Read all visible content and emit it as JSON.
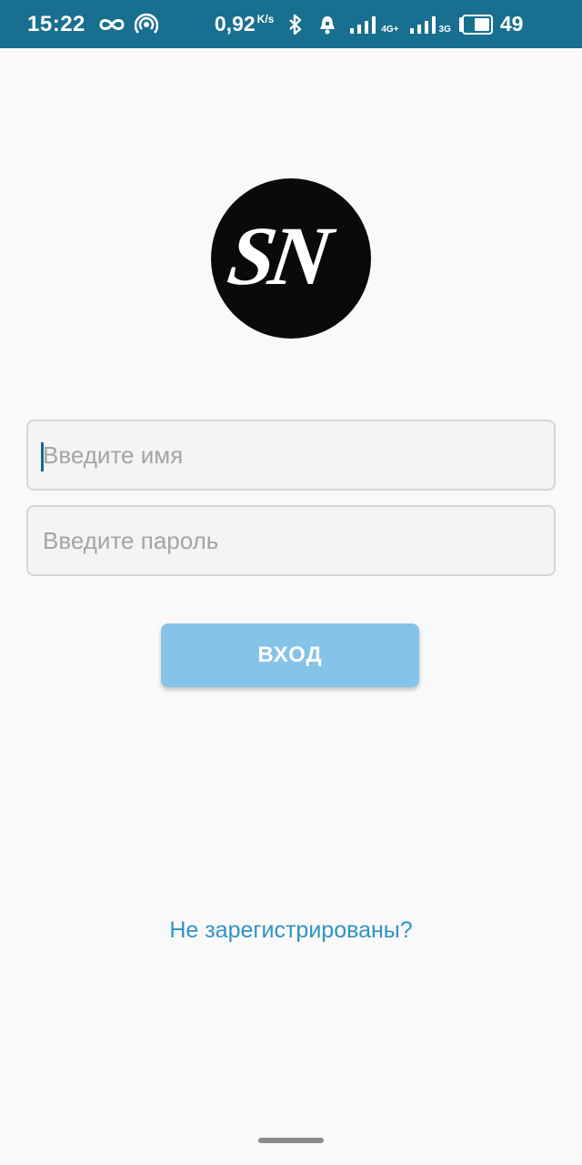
{
  "status_bar": {
    "time": "15:22",
    "net_speed": "0,92",
    "net_speed_unit": "K/s",
    "signal1_type": "4G+",
    "signal2_type": "3G",
    "battery": "49",
    "icons": [
      "infinity-icon",
      "hotspot-icon",
      "bluetooth-icon",
      "alarm-icon",
      "signal-icon",
      "battery-icon"
    ]
  },
  "logo": {
    "text": "SN"
  },
  "form": {
    "username_placeholder": "Введите имя",
    "password_placeholder": "Введите пароль",
    "username_value": "",
    "password_value": "",
    "login_label": "ВХОД"
  },
  "register_link": "Не зарегистрированы?",
  "colors": {
    "status_bar": "#196f8f",
    "background": "#f9f9f9",
    "button": "#85c3e8",
    "link": "#2f93c3",
    "caret": "#0e6b8e"
  }
}
